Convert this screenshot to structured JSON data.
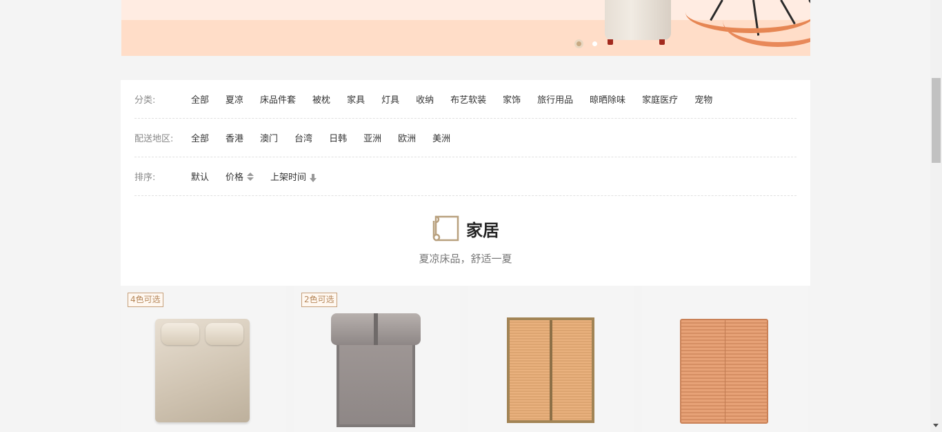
{
  "banner": {
    "slides": 2,
    "active_slide": 1
  },
  "filters": {
    "category": {
      "label": "分类:",
      "options": [
        "全部",
        "夏凉",
        "床品件套",
        "被枕",
        "家具",
        "灯具",
        "收纳",
        "布艺软装",
        "家饰",
        "旅行用品",
        "晾晒除味",
        "家庭医疗",
        "宠物"
      ]
    },
    "region": {
      "label": "配送地区:",
      "options": [
        "全部",
        "香港",
        "澳门",
        "台湾",
        "日韩",
        "亚洲",
        "欧洲",
        "美洲"
      ]
    },
    "sort": {
      "label": "排序:",
      "options": [
        "默认",
        "价格",
        "上架时间"
      ]
    }
  },
  "section": {
    "title": "家居",
    "subtitle": "夏凉床品，舒适一夏",
    "icon": "scroll-icon"
  },
  "products": [
    {
      "tag": "4色可选",
      "image": "beige-silk-mat-set"
    },
    {
      "tag": "2色可选",
      "image": "grey-mat-set"
    },
    {
      "tag": "",
      "image": "bamboo-mat"
    },
    {
      "tag": "",
      "image": "bamboo-mat-orange"
    }
  ],
  "colors": {
    "accent": "#b58659",
    "tag_border": "#c59e78",
    "banner_bg": "#ffddc8"
  }
}
